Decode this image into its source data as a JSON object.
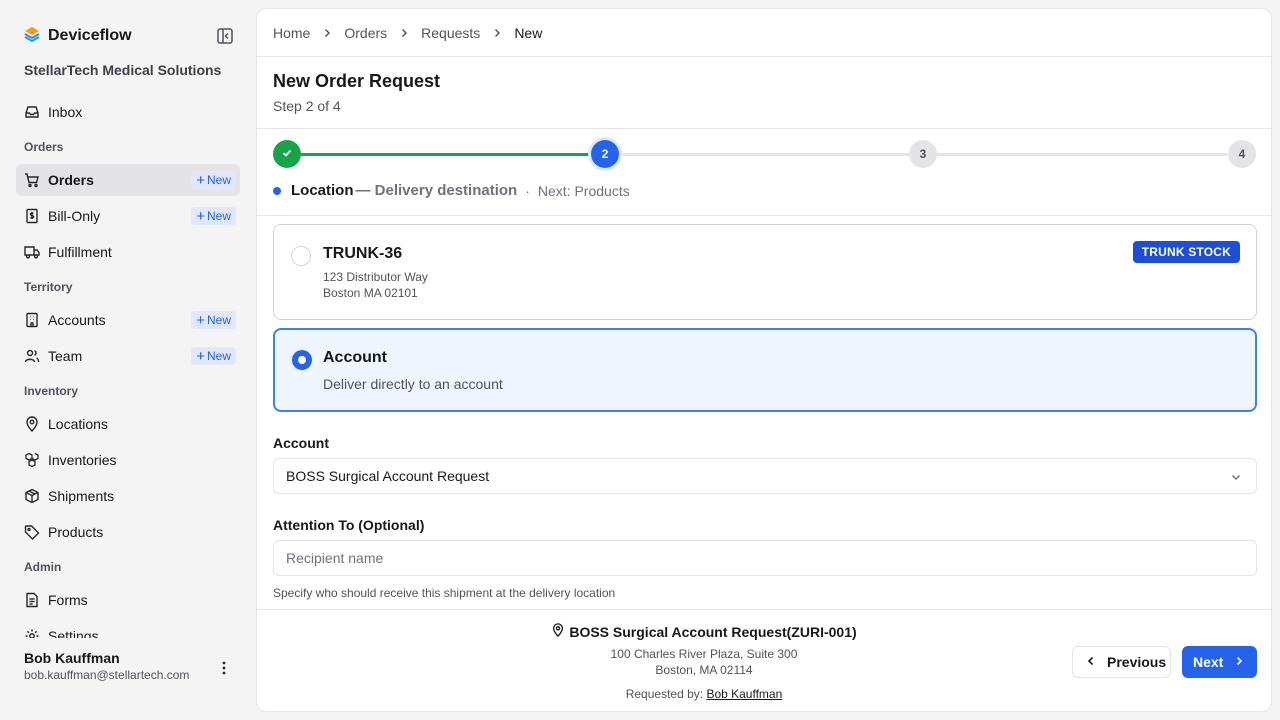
{
  "app": {
    "name": "Deviceflow",
    "organization": "StellarTech Medical Solutions"
  },
  "sidebar": {
    "new_label": "New",
    "items": [
      {
        "label": "Inbox"
      },
      {
        "section": "Orders"
      },
      {
        "label": "Orders",
        "active": true,
        "has_new": true
      },
      {
        "label": "Bill-Only",
        "has_new": true
      },
      {
        "label": "Fulfillment"
      },
      {
        "section": "Territory"
      },
      {
        "label": "Accounts",
        "has_new": true
      },
      {
        "label": "Team",
        "has_new": true
      },
      {
        "section": "Inventory"
      },
      {
        "label": "Locations"
      },
      {
        "label": "Inventories"
      },
      {
        "label": "Shipments"
      },
      {
        "label": "Products"
      },
      {
        "section": "Admin"
      },
      {
        "label": "Forms"
      },
      {
        "label": "Settings"
      }
    ]
  },
  "user": {
    "name": "Bob Kauffman",
    "email": "bob.kauffman@stellartech.com"
  },
  "breadcrumb": [
    "Home",
    "Orders",
    "Requests",
    "New"
  ],
  "page": {
    "title": "New Order Request",
    "subtitle": "Step 2 of 4"
  },
  "stepper": {
    "steps": [
      {
        "number": "1",
        "status": "done"
      },
      {
        "number": "2",
        "status": "current"
      },
      {
        "number": "3",
        "status": "todo"
      },
      {
        "number": "4",
        "status": "todo"
      }
    ],
    "current_name": "Location",
    "current_desc": "— Delivery destination",
    "separator": "·",
    "next_text": "Next: Products"
  },
  "options": {
    "trunk": {
      "title": "TRUNK-36",
      "line1": "123 Distributor Way",
      "line2": "Boston MA 02101",
      "badge": "TRUNK STOCK",
      "selected": false
    },
    "account": {
      "title": "Account",
      "desc": "Deliver directly to an account",
      "selected": true
    }
  },
  "form": {
    "account_label": "Account",
    "account_value": "BOSS Surgical Account Request",
    "attention_label": "Attention To (Optional)",
    "attention_placeholder": "Recipient name",
    "attention_help": "Specify who should receive this shipment at the delivery location"
  },
  "footer": {
    "summary_title": "BOSS Surgical Account Request(ZURI-001)",
    "address1": "100 Charles River Plaza, Suite 300",
    "address2": "Boston, MA 02114",
    "requested_by_label": "Requested by:",
    "requested_by_name": "Bob Kauffman",
    "prev_label": "Previous",
    "next_label": "Next"
  },
  "colors": {
    "primary": "#2563eb",
    "success": "#16a34a",
    "selected_bg": "#eff6ff",
    "badge_bg": "#1d4ed8"
  },
  "icons": {
    "brand": "deviceflow-logo-icon",
    "collapse": "sidebar-collapse-icon",
    "inbox": "inbox-icon",
    "orders": "shopping-cart-icon",
    "bill_only": "receipt-dollar-icon",
    "fulfillment": "truck-icon",
    "accounts": "building-icon",
    "team": "users-icon",
    "locations": "map-pin-icon",
    "inventories": "boxes-icon",
    "shipments": "package-icon",
    "products": "tag-icon",
    "forms": "file-text-icon",
    "settings": "gear-icon",
    "user_menu": "more-vertical-icon",
    "breadcrumb_sep": "chevron-right-icon",
    "step_done": "check-icon",
    "select": "chevron-down-icon",
    "summary": "map-pin-icon",
    "prev": "chevron-left-icon",
    "next": "chevron-right-icon"
  }
}
